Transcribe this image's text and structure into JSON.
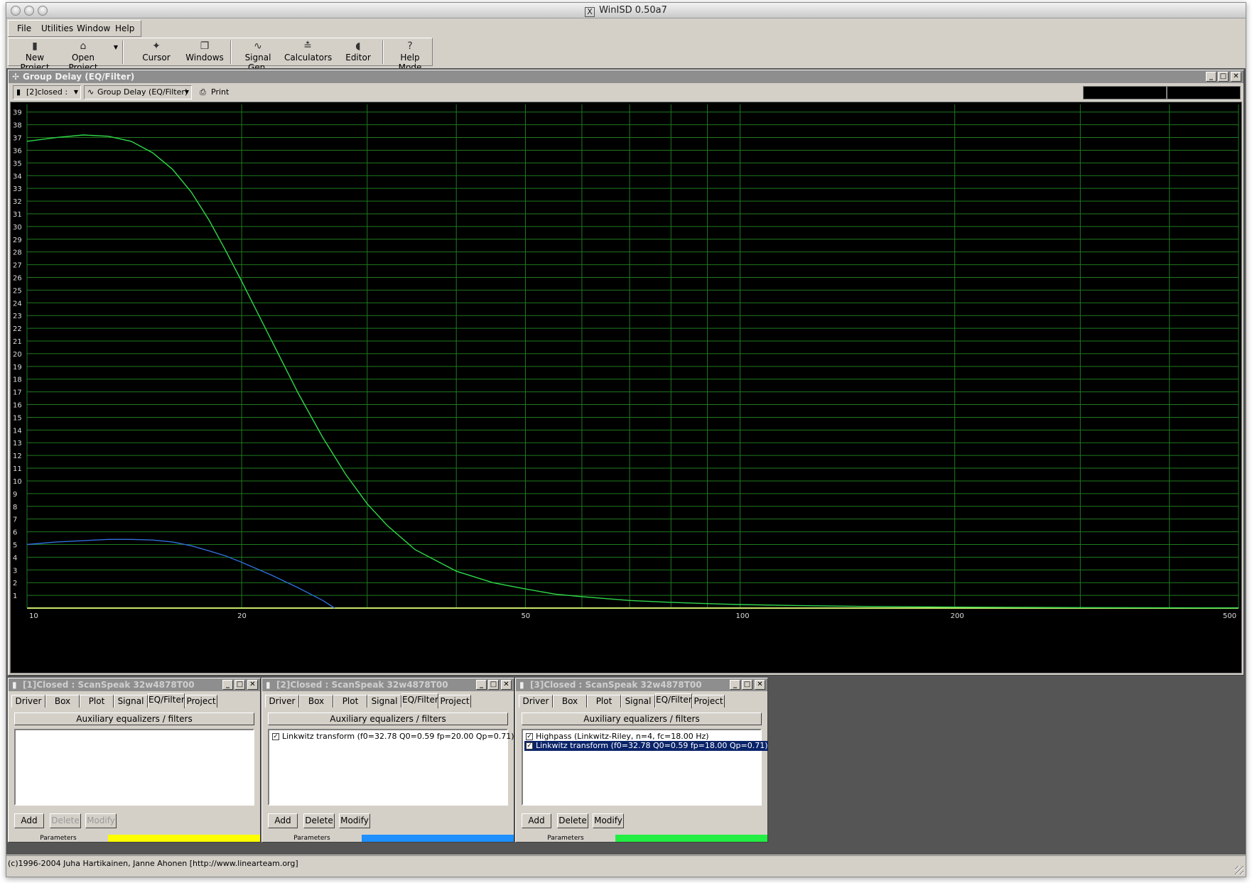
{
  "window": {
    "title": "WinISD 0.50a7",
    "x_logo": "X"
  },
  "menu": [
    {
      "id": "file",
      "label": "File"
    },
    {
      "id": "utilities",
      "label": "Utilities"
    },
    {
      "id": "window",
      "label": "Window"
    },
    {
      "id": "help",
      "label": "Help"
    }
  ],
  "toolbar": {
    "new_project": "New Project",
    "open_project": "Open Project",
    "cursor": "Cursor",
    "windows": "Windows",
    "signal_gen": "Signal Gen.",
    "calculators": "Calculators",
    "editor": "Editor",
    "help_mode": "Help Mode"
  },
  "graph_window": {
    "title": "Group Delay (EQ/Filter)",
    "project_select": "[2]closed :",
    "plot_select": "Group Delay (EQ/Filter)",
    "print_label": "Print"
  },
  "chart_data": {
    "type": "line",
    "title": "",
    "xlabel": "",
    "ylabel": "",
    "x_scale": "log",
    "xlim": [
      10,
      500
    ],
    "ylim": [
      0,
      39.6
    ],
    "x_tick_labels": [
      "10",
      "20",
      "50",
      "100",
      "200",
      "500"
    ],
    "y_tick_labels": [
      "1",
      "2",
      "3",
      "4",
      "5",
      "6",
      "7",
      "8",
      "9",
      "10",
      "11",
      "12",
      "13",
      "14",
      "15",
      "16",
      "17",
      "18",
      "19",
      "20",
      "21",
      "22",
      "23",
      "24",
      "25",
      "26",
      "27",
      "28",
      "29",
      "30",
      "31",
      "32",
      "33",
      "34",
      "35",
      "36",
      "37",
      "38",
      "39"
    ],
    "grid": true,
    "colors": {
      "background": "#000000",
      "grid": "#1f7a1f",
      "tick_text": "#dddddd"
    },
    "series": [
      {
        "color": "#2fd84a",
        "x": [
          10,
          11,
          12,
          13,
          14,
          15,
          16,
          17,
          18,
          19,
          20,
          22,
          24,
          26,
          28,
          30,
          32,
          35,
          40,
          45,
          50,
          55,
          60,
          70,
          80,
          90,
          100,
          120,
          150,
          200,
          300,
          400,
          500
        ],
        "y": [
          36.7,
          37.0,
          37.2,
          37.1,
          36.7,
          35.8,
          34.5,
          32.7,
          30.5,
          28.1,
          25.7,
          21.1,
          16.9,
          13.4,
          10.5,
          8.2,
          6.5,
          4.6,
          2.9,
          2.0,
          1.5,
          1.1,
          0.9,
          0.6,
          0.45,
          0.35,
          0.28,
          0.2,
          0.13,
          0.08,
          0.04,
          0.02,
          0.01
        ]
      },
      {
        "color": "#2f6fdc",
        "x": [
          10,
          11,
          12,
          13,
          14,
          15,
          16,
          17,
          18,
          19,
          20,
          22,
          24,
          26,
          27
        ],
        "y": [
          5.0,
          5.2,
          5.3,
          5.4,
          5.4,
          5.35,
          5.2,
          4.9,
          4.5,
          4.1,
          3.6,
          2.6,
          1.6,
          0.6,
          0.0
        ]
      }
    ]
  },
  "project_windows": [
    {
      "title": "[1]Closed : ScanSpeak 32w4878T00",
      "tabs": [
        "Driver",
        "Box",
        "Plot",
        "Signal",
        "EQ/Filter",
        "Project"
      ],
      "active_tab": "EQ/Filter",
      "aux_button": "Auxiliary equalizers / filters",
      "filters": [],
      "buttons": {
        "add": "Add",
        "delete": "Delete",
        "modify": "Modify"
      },
      "params_label": "Parameters",
      "color": "#ffff00"
    },
    {
      "title": "[2]Closed : ScanSpeak 32w4878T00",
      "tabs": [
        "Driver",
        "Box",
        "Plot",
        "Signal",
        "EQ/Filter",
        "Project"
      ],
      "active_tab": "EQ/Filter",
      "aux_button": "Auxiliary equalizers / filters",
      "filters": [
        {
          "label": "Linkwitz transform (f0=32.78 Q0=0.59 fp=20.00 Qp=0.71)",
          "checked": true,
          "selected": false
        }
      ],
      "buttons": {
        "add": "Add",
        "delete": "Delete",
        "modify": "Modify"
      },
      "params_label": "Parameters",
      "color": "#1e90ff"
    },
    {
      "title": "[3]Closed : ScanSpeak 32w4878T00",
      "tabs": [
        "Driver",
        "Box",
        "Plot",
        "Signal",
        "EQ/Filter",
        "Project"
      ],
      "active_tab": "EQ/Filter",
      "aux_button": "Auxiliary equalizers / filters",
      "filters": [
        {
          "label": "Highpass (Linkwitz-Riley, n=4, fc=18.00 Hz)",
          "checked": true,
          "selected": false
        },
        {
          "label": "Linkwitz transform (f0=32.78 Q0=0.59 fp=18.00 Qp=0.71)",
          "checked": true,
          "selected": true
        }
      ],
      "buttons": {
        "add": "Add",
        "delete": "Delete",
        "modify": "Modify"
      },
      "params_label": "Parameters",
      "color": "#22ee44"
    }
  ],
  "status": "(c)1996-2004 Juha Hartikainen, Janne Ahonen [http://www.linearteam.org]"
}
